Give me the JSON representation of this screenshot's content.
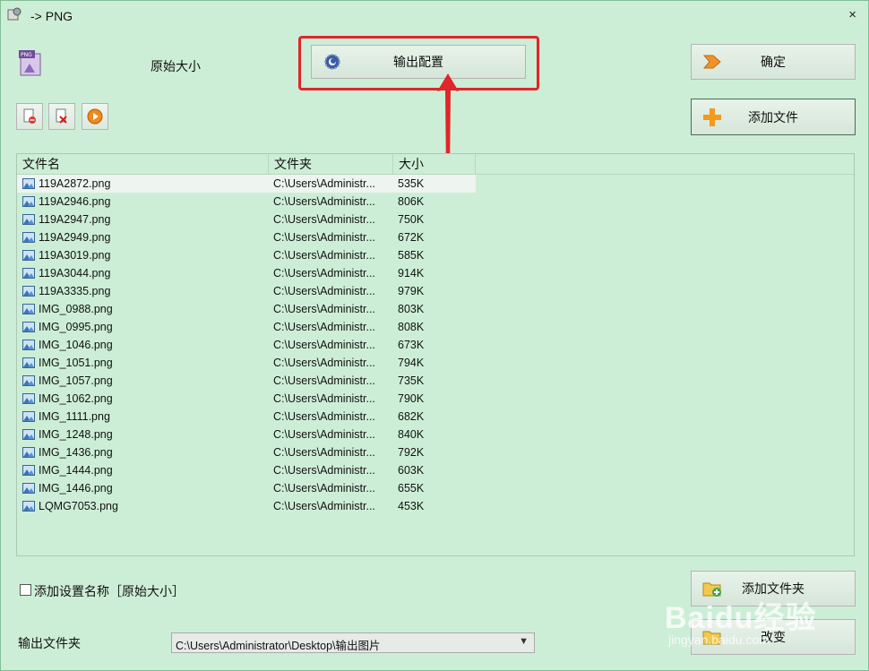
{
  "window": {
    "title": "-> PNG",
    "close_label": "×"
  },
  "preset": {
    "label": "原始大小"
  },
  "buttons": {
    "output_config": "输出配置",
    "ok": "确定",
    "add_file": "添加文件",
    "add_folder": "添加文件夹",
    "change": "改变"
  },
  "list": {
    "headers": [
      "文件名",
      "文件夹",
      "大小"
    ],
    "rows": [
      {
        "name": "119A2872.png",
        "folder": "C:\\Users\\Administr...",
        "size": "535K"
      },
      {
        "name": "119A2946.png",
        "folder": "C:\\Users\\Administr...",
        "size": "806K"
      },
      {
        "name": "119A2947.png",
        "folder": "C:\\Users\\Administr...",
        "size": "750K"
      },
      {
        "name": "119A2949.png",
        "folder": "C:\\Users\\Administr...",
        "size": "672K"
      },
      {
        "name": "119A3019.png",
        "folder": "C:\\Users\\Administr...",
        "size": "585K"
      },
      {
        "name": "119A3044.png",
        "folder": "C:\\Users\\Administr...",
        "size": "914K"
      },
      {
        "name": "119A3335.png",
        "folder": "C:\\Users\\Administr...",
        "size": "979K"
      },
      {
        "name": "IMG_0988.png",
        "folder": "C:\\Users\\Administr...",
        "size": "803K"
      },
      {
        "name": "IMG_0995.png",
        "folder": "C:\\Users\\Administr...",
        "size": "808K"
      },
      {
        "name": "IMG_1046.png",
        "folder": "C:\\Users\\Administr...",
        "size": "673K"
      },
      {
        "name": "IMG_1051.png",
        "folder": "C:\\Users\\Administr...",
        "size": "794K"
      },
      {
        "name": "IMG_1057.png",
        "folder": "C:\\Users\\Administr...",
        "size": "735K"
      },
      {
        "name": "IMG_1062.png",
        "folder": "C:\\Users\\Administr...",
        "size": "790K"
      },
      {
        "name": "IMG_1111.png",
        "folder": "C:\\Users\\Administr...",
        "size": "682K"
      },
      {
        "name": "IMG_1248.png",
        "folder": "C:\\Users\\Administr...",
        "size": "840K"
      },
      {
        "name": "IMG_1436.png",
        "folder": "C:\\Users\\Administr...",
        "size": "792K"
      },
      {
        "name": "IMG_1444.png",
        "folder": "C:\\Users\\Administr...",
        "size": "603K"
      },
      {
        "name": "IMG_1446.png",
        "folder": "C:\\Users\\Administr...",
        "size": "655K"
      },
      {
        "name": "LQMG7053.png",
        "folder": "C:\\Users\\Administr...",
        "size": "453K"
      }
    ]
  },
  "options": {
    "add_setting_name": "添加设置名称［原始大小］"
  },
  "output": {
    "label": "输出文件夹",
    "path": "C:\\Users\\Administrator\\Desktop\\输出图片"
  },
  "watermark": {
    "text": "Baidu经验",
    "sub": "jingyan.baidu.com"
  },
  "colors": {
    "background": "#cdeed6",
    "highlight": "#e0262a",
    "add_icon": "#f39a1e"
  }
}
